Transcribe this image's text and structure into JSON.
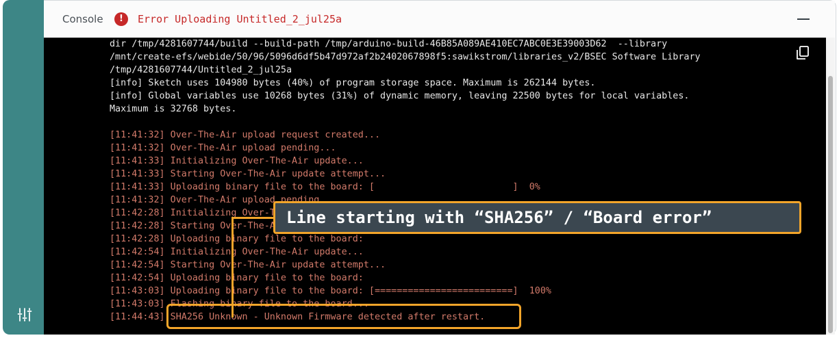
{
  "sidebar": {
    "tune_icon": "tune-sliders-icon",
    "color": "#3d8686"
  },
  "header": {
    "title": "Console",
    "error_icon": "error-icon",
    "error_glyph": "!",
    "status": "Error Uploading Untitled_2_jul25a",
    "collapse_icon": "minimize-icon"
  },
  "console": {
    "copy_icon": "copy-icon",
    "lines": [
      {
        "kind": "info",
        "text": "dir /tmp/4281607744/build --build-path /tmp/arduino-build-46B85A089AE410EC7ABC0E3E39003D62  --library"
      },
      {
        "kind": "info",
        "text": "/mnt/create-efs/webide/50/96/5096d6df5b47d972af2b2402067898f5:sawikstrom/libraries_v2/BSEC Software Library"
      },
      {
        "kind": "info",
        "text": "/tmp/4281607744/Untitled_2_jul25a"
      },
      {
        "kind": "info",
        "text": "[info] Sketch uses 104980 bytes (40%) of program storage space. Maximum is 262144 bytes."
      },
      {
        "kind": "info",
        "text": "[info] Global variables use 10268 bytes (31%) of dynamic memory, leaving 22500 bytes for local variables."
      },
      {
        "kind": "info",
        "text": "Maximum is 32768 bytes."
      },
      {
        "kind": "info",
        "text": ""
      },
      {
        "kind": "ota",
        "text": "[11:41:32] Over-The-Air upload request created..."
      },
      {
        "kind": "ota",
        "text": "[11:41:32] Over-The-Air upload pending..."
      },
      {
        "kind": "ota",
        "text": "[11:41:33] Initializing Over-The-Air update..."
      },
      {
        "kind": "ota",
        "text": "[11:41:33] Starting Over-The-Air update attempt..."
      },
      {
        "kind": "ota",
        "text": "[11:41:33] Uploading binary file to the board: [                         ]  0%"
      },
      {
        "kind": "ota",
        "text": "[11:41:32] Over-The-Air upload pending..."
      },
      {
        "kind": "ota",
        "text": "[11:42:28] Initializing Over-The-Air update..."
      },
      {
        "kind": "ota",
        "text": "[11:42:28] Starting Over-The-Air update attempt..."
      },
      {
        "kind": "ota",
        "text": "[11:42:28] Uploading binary file to the board:"
      },
      {
        "kind": "ota",
        "text": "[11:42:54] Initializing Over-The-Air update..."
      },
      {
        "kind": "ota",
        "text": "[11:42:54] Starting Over-The-Air update attempt..."
      },
      {
        "kind": "ota",
        "text": "[11:42:54] Uploading binary file to the board:"
      },
      {
        "kind": "ota",
        "text": "[11:43:03] Uploading binary file to the board: [=========================]  100%"
      },
      {
        "kind": "ota",
        "text": "[11:43:03] Flashing binary file to the board..."
      },
      {
        "kind": "ota",
        "text": "[11:44:43] SHA256 Unknown - Unknown Firmware detected after restart."
      }
    ]
  },
  "annotation": {
    "label": "Line starting with “SHA256” / “Board error”",
    "accent": "#f3a52a"
  }
}
